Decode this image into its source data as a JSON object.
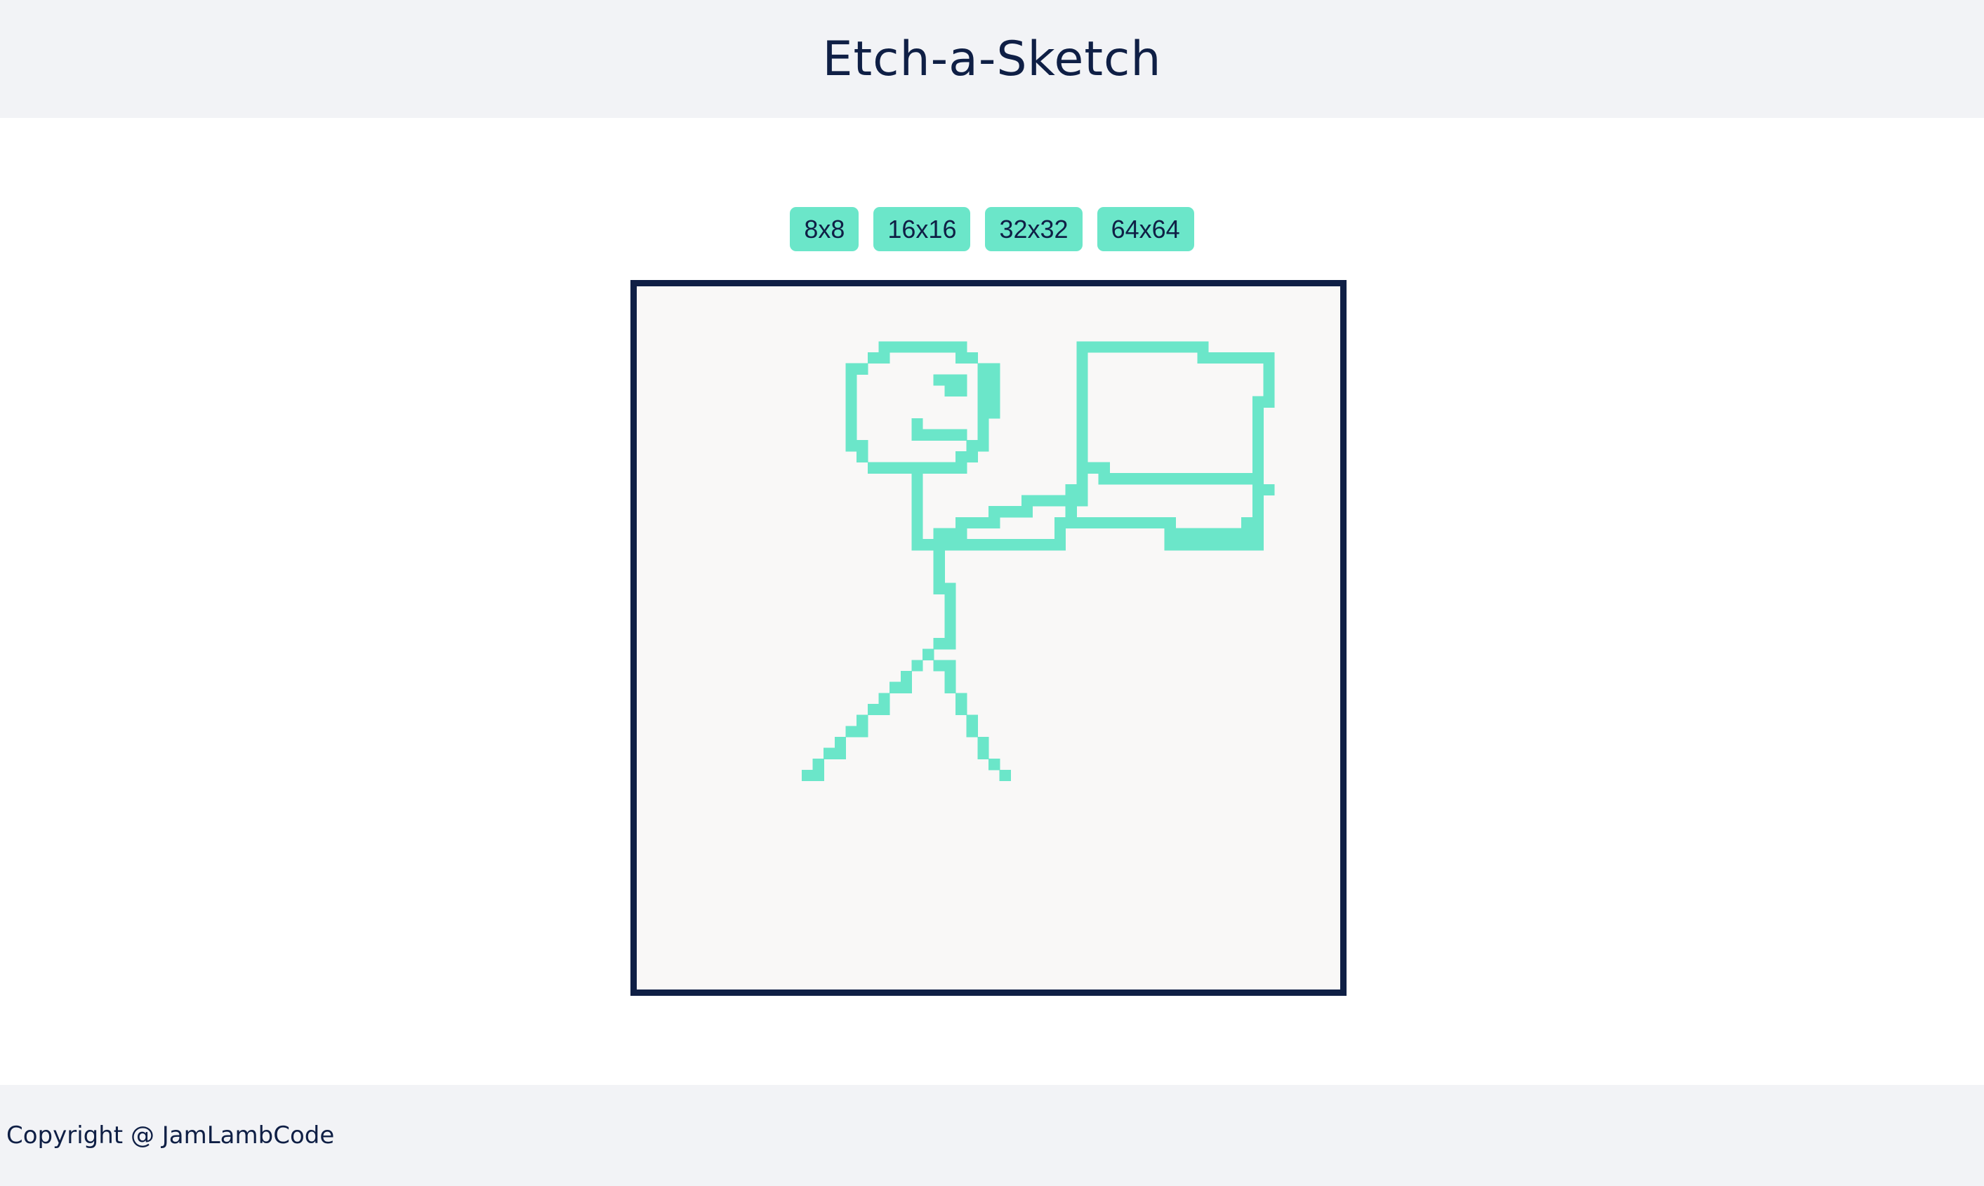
{
  "header": {
    "title": "Etch-a-Sketch"
  },
  "controls": {
    "sizes": [
      {
        "label": "8x8"
      },
      {
        "label": "16x16"
      },
      {
        "label": "32x32"
      },
      {
        "label": "64x64"
      }
    ]
  },
  "board": {
    "grid_size": 64,
    "background_color": "#f9f8f7",
    "ink_color": "#6be6c9",
    "border_color": "#0f1f45",
    "drawing_description_icon": "stick-figure-holding-laptop"
  },
  "footer": {
    "copyright": "Copyright @ JamLambCode"
  }
}
